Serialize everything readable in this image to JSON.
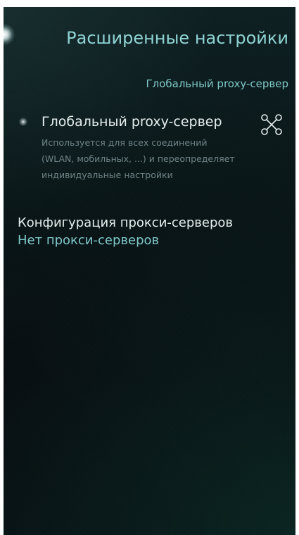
{
  "page": {
    "title": "Расширенные настройки"
  },
  "section": {
    "header": "Глобальный proxy-сервер"
  },
  "global_proxy": {
    "title": "Глобальный proxy-сервер",
    "description": "Используется для всех соединений (WLAN, мобильных, ...) и переопределяет индивидуальные настройки",
    "icon": "network-nodes-icon",
    "enabled": false
  },
  "proxy_config": {
    "label": "Конфигурация прокси-серверов",
    "value": "Нет прокси-серверов"
  },
  "colors": {
    "accent": "#7ec8c8",
    "primary_text": "#e6eeee",
    "secondary_text": "#6f8386",
    "background": "#081416"
  }
}
